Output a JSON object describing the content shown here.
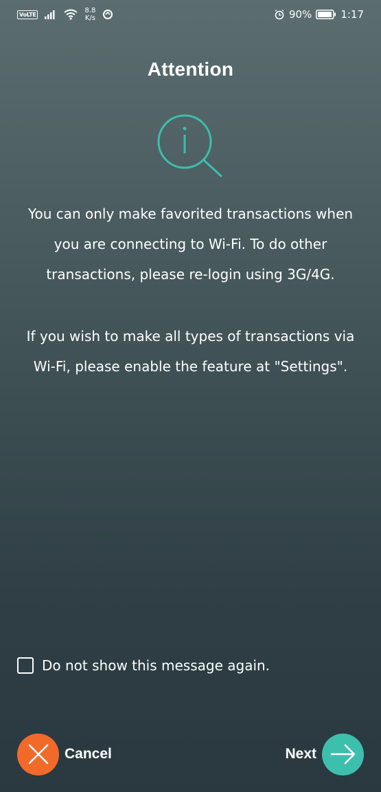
{
  "status_bar": {
    "network_badge": "VoLTE",
    "speed_value": "8.8",
    "speed_unit": "K/s",
    "battery": "90%",
    "time": "1:17"
  },
  "dialog": {
    "title": "Attention",
    "icon": "info-search-icon",
    "message_paragraph_1": "You can only make favorited transactions when you are connecting to Wi-Fi. To do other transactions, please re-login using 3G/4G.",
    "message_paragraph_2": "If you wish to make all types of transactions via Wi-Fi, please enable the feature at \"Settings\".",
    "checkbox": {
      "label": "Do not show this message again.",
      "checked": false
    },
    "cancel_label": "Cancel",
    "next_label": "Next"
  },
  "colors": {
    "accent_teal": "#3dbfae",
    "cancel_orange": "#f26a2a",
    "background_top": "#5b6d6f",
    "background_bottom": "#2a393f"
  }
}
